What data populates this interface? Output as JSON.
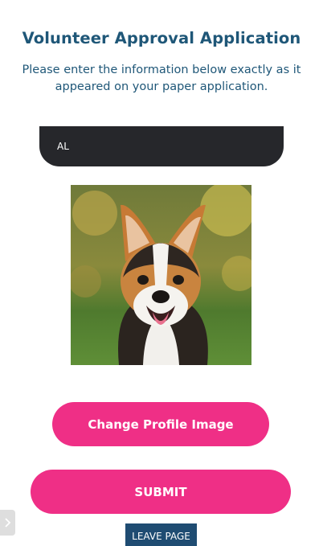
{
  "page": {
    "title": "Volunteer Approval Application",
    "subtitle": "Please enter the information below exactly as it appeared on your paper application."
  },
  "form": {
    "name_value": "AL"
  },
  "profile": {
    "image_alt": "corgi-dog-photo"
  },
  "buttons": {
    "change_profile": "Change Profile Image",
    "submit": "SUBMIT",
    "leave": "LEAVE PAGE"
  },
  "icons": {
    "side_tab": "chevron-right-icon"
  },
  "colors": {
    "title": "#1f5778",
    "accent_pink": "#ef2f86",
    "field_dark": "#26272b",
    "leave_button": "#1f4c72"
  }
}
